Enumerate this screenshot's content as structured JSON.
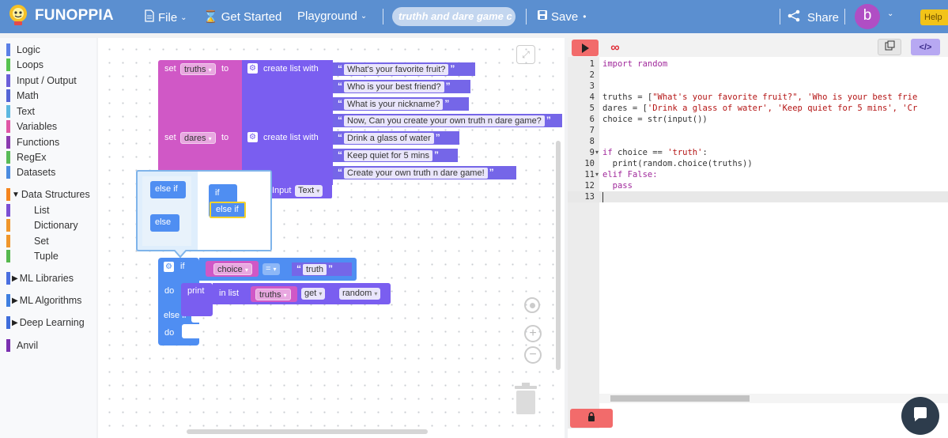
{
  "app": {
    "name": "FUNOPPIA",
    "project_name": "truthh and dare game c"
  },
  "nav": {
    "file": "File",
    "get_started": "Get Started",
    "playground": "Playground",
    "save": "Save",
    "save_dot": "•",
    "share": "Share",
    "user_initial": "b",
    "help": "Help"
  },
  "sidebar": {
    "items": [
      {
        "label": "Logic",
        "color": "#5b80e6"
      },
      {
        "label": "Loops",
        "color": "#56c24f"
      },
      {
        "label": "Input / Output",
        "color": "#6b5ed8"
      },
      {
        "label": "Math",
        "color": "#5565d6"
      },
      {
        "label": "Text",
        "color": "#5db8e0"
      },
      {
        "label": "Variables",
        "color": "#e057a6"
      },
      {
        "label": "Functions",
        "color": "#8b3bb0"
      },
      {
        "label": "RegEx",
        "color": "#58bb58"
      },
      {
        "label": "Datasets",
        "color": "#4b8ce0"
      },
      {
        "label": "Data Structures",
        "color": "#f5851f"
      },
      {
        "label": "List",
        "color": "#7b4fd4"
      },
      {
        "label": "Dictionary",
        "color": "#f0962b"
      },
      {
        "label": "Set",
        "color": "#f0962b"
      },
      {
        "label": "Tuple",
        "color": "#56b84e"
      },
      {
        "label": "ML Libraries",
        "color": "#4a6fe0"
      },
      {
        "label": "ML Algorithms",
        "color": "#3f7fe0"
      },
      {
        "label": "Deep Learning",
        "color": "#3f6ddb"
      },
      {
        "label": "Anvil",
        "color": "#7a2fb0"
      }
    ],
    "expanded_arrow": "▼",
    "collapsed_arrow": "▶"
  },
  "blocks": {
    "set": "set",
    "to": "to",
    "create_list": "create list with",
    "var_truths": "truths",
    "var_dares": "dares",
    "var_choice": "choice",
    "truths_items": [
      "What's your favorite fruit?",
      "Who is your best friend?",
      "What is your nickname?",
      "Now, Can you create your own truth n dare game?"
    ],
    "dares_items": [
      "Drink a glass of water",
      "Keep quiet for 5 mins",
      "Create your own truth n dare game!"
    ],
    "input": "Input",
    "text_type": "Text",
    "popup": {
      "else_if": "else if",
      "else": "else",
      "if": "if",
      "else_if2": "else if"
    },
    "if": "if",
    "do": "do",
    "else_if": "else if",
    "do2": "do",
    "equals": "=",
    "truth_literal": "truth",
    "print": "print",
    "in_list": "in list",
    "get": "get",
    "random": "random"
  },
  "code": {
    "lines": [
      "1",
      "2",
      "3",
      "4",
      "5",
      "6",
      "7",
      "8",
      "9",
      "10",
      "11",
      "12",
      "13"
    ],
    "l1": "import random",
    "l4a": "truths = [",
    "l4b": "\"What's your favorite fruit?\", 'Who is your best frie",
    "l5a": "dares = [",
    "l5b": "'Drink a glass of water', 'Keep quiet for 5 mins', 'Cr",
    "l6": "choice = str(input())",
    "l9a": "if",
    "l9b": " choice == ",
    "l9c": "'truth'",
    "l9d": ":",
    "l10": "  print(random.choice(truths))",
    "l11a": "elif",
    "l11b": " False:",
    "l12": "  pass"
  },
  "colors": {
    "topbar": "#5b8fd0",
    "variable": "#d058c6",
    "list": "#7a5ef0",
    "control": "#4f8ef2",
    "text": "#7566e8"
  }
}
